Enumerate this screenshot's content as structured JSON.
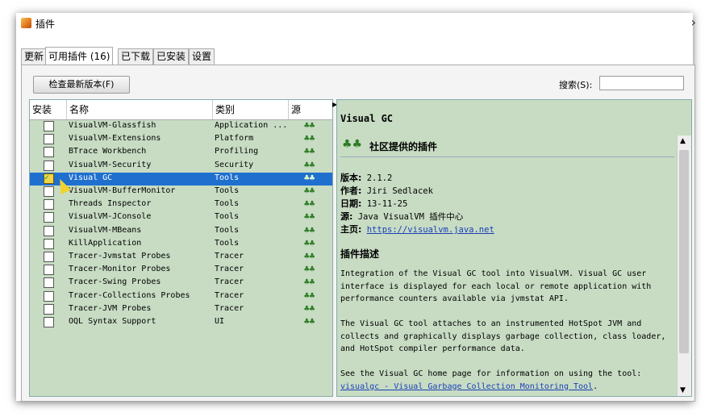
{
  "window": {
    "title": "插件"
  },
  "tabs": [
    {
      "label": "更新",
      "active": false
    },
    {
      "label": "可用插件 (16)",
      "active": true
    },
    {
      "label": "已下载",
      "active": false
    },
    {
      "label": "已安装",
      "active": false
    },
    {
      "label": "设置",
      "active": false
    }
  ],
  "toolbar": {
    "check_button": "检查最新版本(F)",
    "search_label": "搜索(S):",
    "search_value": ""
  },
  "list": {
    "headers": {
      "install": "安装",
      "name": "名称",
      "category": "类别",
      "source": "源"
    },
    "rows": [
      {
        "name": "VisualVM-Glassfish",
        "category": "Application ...",
        "checked": false,
        "selected": false,
        "source_icon": "community-icon"
      },
      {
        "name": "VisualVM-Extensions",
        "category": "Platform",
        "checked": false,
        "selected": false,
        "source_icon": "community-icon"
      },
      {
        "name": "BTrace Workbench",
        "category": "Profiling",
        "checked": false,
        "selected": false,
        "source_icon": "community-icon"
      },
      {
        "name": "VisualVM-Security",
        "category": "Security",
        "checked": false,
        "selected": false,
        "source_icon": "community-icon"
      },
      {
        "name": "Visual GC",
        "category": "Tools",
        "checked": true,
        "selected": true,
        "source_icon": "community-icon"
      },
      {
        "name": "VisualVM-BufferMonitor",
        "category": "Tools",
        "checked": false,
        "selected": false,
        "source_icon": "community-icon"
      },
      {
        "name": "Threads Inspector",
        "category": "Tools",
        "checked": false,
        "selected": false,
        "source_icon": "community-icon"
      },
      {
        "name": "VisualVM-JConsole",
        "category": "Tools",
        "checked": false,
        "selected": false,
        "source_icon": "community-icon"
      },
      {
        "name": "VisualVM-MBeans",
        "category": "Tools",
        "checked": false,
        "selected": false,
        "source_icon": "community-icon"
      },
      {
        "name": "KillApplication",
        "category": "Tools",
        "checked": false,
        "selected": false,
        "source_icon": "community-icon"
      },
      {
        "name": "Tracer-Jvmstat Probes",
        "category": "Tracer",
        "checked": false,
        "selected": false,
        "source_icon": "community-icon"
      },
      {
        "name": "Tracer-Monitor Probes",
        "category": "Tracer",
        "checked": false,
        "selected": false,
        "source_icon": "community-icon"
      },
      {
        "name": "Tracer-Swing Probes",
        "category": "Tracer",
        "checked": false,
        "selected": false,
        "source_icon": "community-icon"
      },
      {
        "name": "Tracer-Collections Probes",
        "category": "Tracer",
        "checked": false,
        "selected": false,
        "source_icon": "community-icon"
      },
      {
        "name": "Tracer-JVM Probes",
        "category": "Tracer",
        "checked": false,
        "selected": false,
        "source_icon": "community-icon"
      },
      {
        "name": "OQL Syntax Support",
        "category": "UI",
        "checked": false,
        "selected": false,
        "source_icon": "community-icon"
      }
    ]
  },
  "detail": {
    "title": "Visual GC",
    "community": "社区提供的插件",
    "version_label": "版本:",
    "version": "2.1.2",
    "author_label": "作者:",
    "author": "Jiri Sedlacek",
    "date_label": "日期:",
    "date": "13-11-25",
    "source_label": "源:",
    "source": "Java VisualVM 插件中心",
    "homepage_label": "主页:",
    "homepage": "https://visualvm.java.net",
    "desc_heading": "插件描述",
    "para1": "Integration of the Visual GC tool into VisualVM. Visual GC user interface is displayed for each local or remote application with performance counters available via jvmstat API.",
    "para2": "The Visual GC tool attaches to an instrumented HotSpot JVM and collects and graphically displays garbage collection, class loader, and HotSpot compiler performance data.",
    "para3_prefix": "See the Visual GC home page for information on using the tool: ",
    "para3_link": "visualgc - Visual Garbage Collection Monitoring Tool",
    "para3_suffix": "."
  },
  "colors": {
    "pane_bg": "#c7dcc3",
    "selection": "#1f6fcf",
    "link": "#1a3fb8"
  }
}
